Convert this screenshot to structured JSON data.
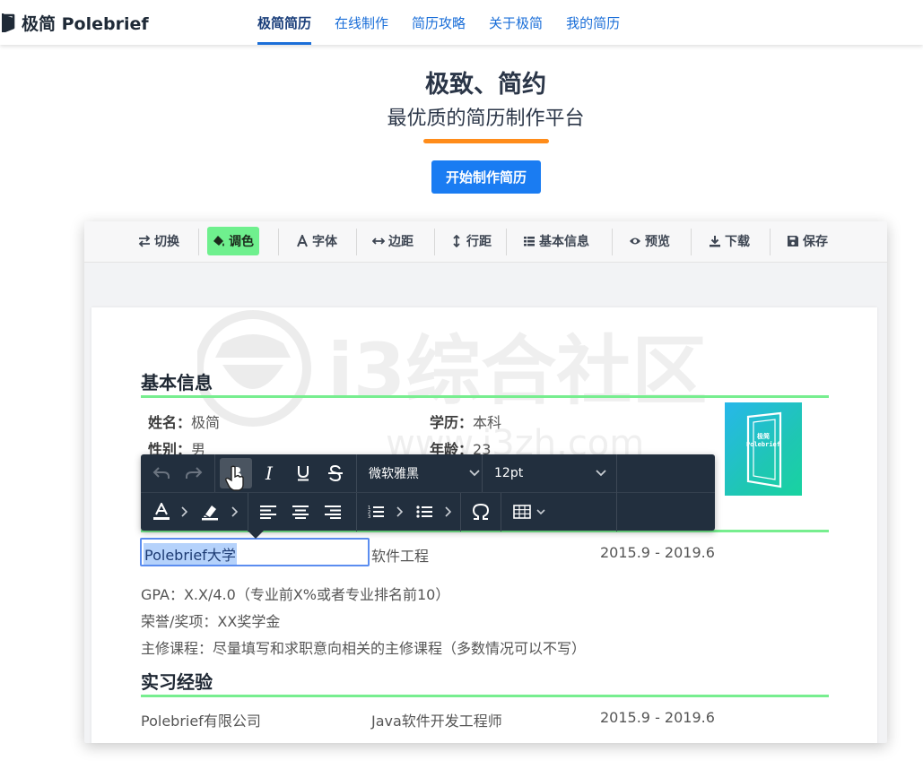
{
  "brand": {
    "name": "极简 Polebrief"
  },
  "nav": {
    "items": [
      {
        "label": "极简简历",
        "active": true
      },
      {
        "label": "在线制作",
        "active": false
      },
      {
        "label": "简历攻略",
        "active": false
      },
      {
        "label": "关于极简",
        "active": false
      },
      {
        "label": "我的简历",
        "active": false
      }
    ]
  },
  "hero": {
    "title": "极致、简约",
    "subtitle": "最优质的简历制作平台",
    "cta_label": "开始制作简历"
  },
  "toolbar": {
    "items": [
      {
        "icon": "swap-icon",
        "label": "切换"
      },
      {
        "icon": "paint-bucket-icon",
        "label": "调色",
        "active": true
      },
      {
        "icon": "font-icon",
        "label": "字体"
      },
      {
        "icon": "horizontal-arrows-icon",
        "label": "边距"
      },
      {
        "icon": "vertical-arrows-icon",
        "label": "行距"
      },
      {
        "icon": "list-icon",
        "label": "基本信息"
      },
      {
        "icon": "eye-icon",
        "label": "预览"
      },
      {
        "icon": "download-icon",
        "label": "下载"
      },
      {
        "icon": "save-icon",
        "label": "保存"
      }
    ]
  },
  "watermark": {
    "text": "i3综合社区",
    "url": "www.i3zh.com"
  },
  "resume": {
    "basic": {
      "title": "基本信息",
      "name_label": "姓名：",
      "name_value": "极简",
      "edu_label": "学历：",
      "edu_value": "本科",
      "gender_label": "性别：",
      "gender_value": "男",
      "age_label": "年龄：",
      "age_value": "23",
      "photo_text": "极简\nPolebrief"
    },
    "education": {
      "school": "Polebrief大学",
      "major": "软件工程",
      "period": "2015.9 - 2019.6",
      "gpa": "GPA：X.X/4.0（专业前X%或者专业排名前10）",
      "honors": "荣誉/奖项：XX奖学金",
      "courses": "主修课程：尽量填写和求职意向相关的主修课程（多数情况可以不写）"
    },
    "internship": {
      "title": "实习经验",
      "company": "Polebrief有限公司",
      "role": "Java软件开发工程师",
      "period": "2015.9 - 2019.6"
    }
  },
  "rich_toolbar": {
    "font_family": "微软雅黑",
    "font_size": "12pt"
  },
  "colors": {
    "accent": "#1a7cf2",
    "section_rule": "#77ee8f",
    "hero_bar": "#ff8c1a",
    "toolbar_active": "#6ff08e"
  }
}
